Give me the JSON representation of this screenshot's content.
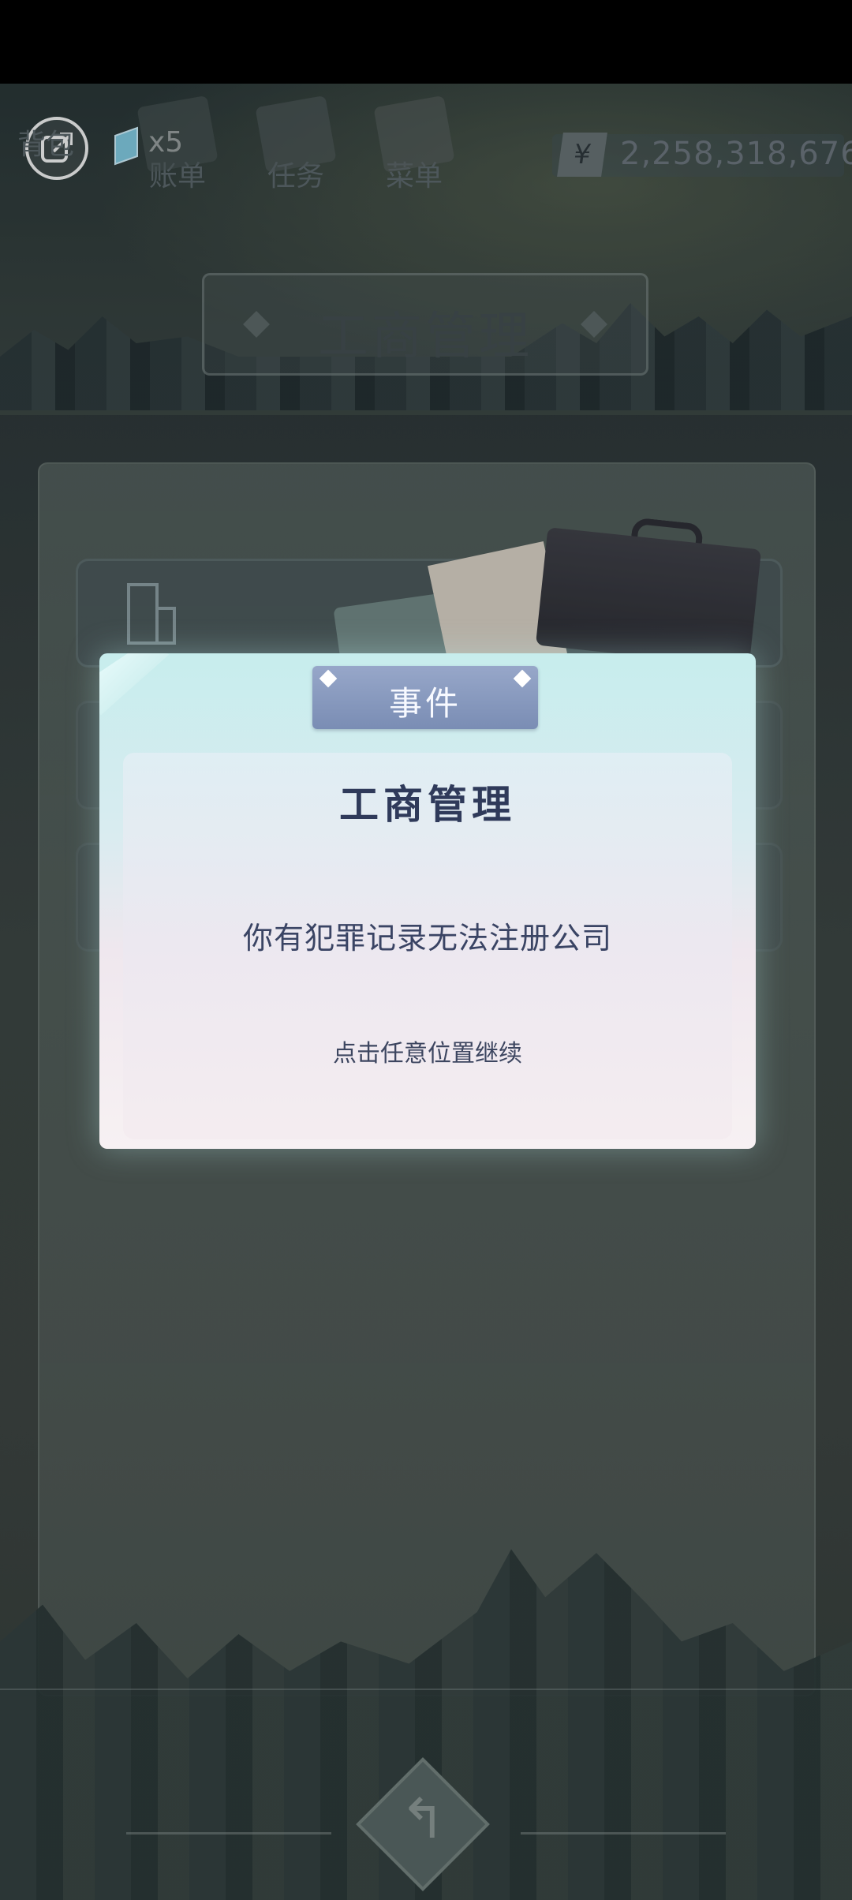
{
  "hud": {
    "gem_count": "x5",
    "nav": [
      {
        "label": "背包",
        "icon": "bag-icon"
      },
      {
        "label": "账单",
        "icon": "bill-icon"
      },
      {
        "label": "任务",
        "icon": "task-icon"
      },
      {
        "label": "菜单",
        "icon": "menu-icon"
      }
    ],
    "currency_symbol": "¥",
    "money": "2,258,318,676"
  },
  "page": {
    "title": "工商管理"
  },
  "dialog": {
    "tab_label": "事件",
    "title": "工商管理",
    "message": "你有犯罪记录无法注册公司",
    "hint": "点击任意位置继续"
  },
  "colors": {
    "dialog_title": "#2f3a5a",
    "tab": "#7a8db4"
  }
}
